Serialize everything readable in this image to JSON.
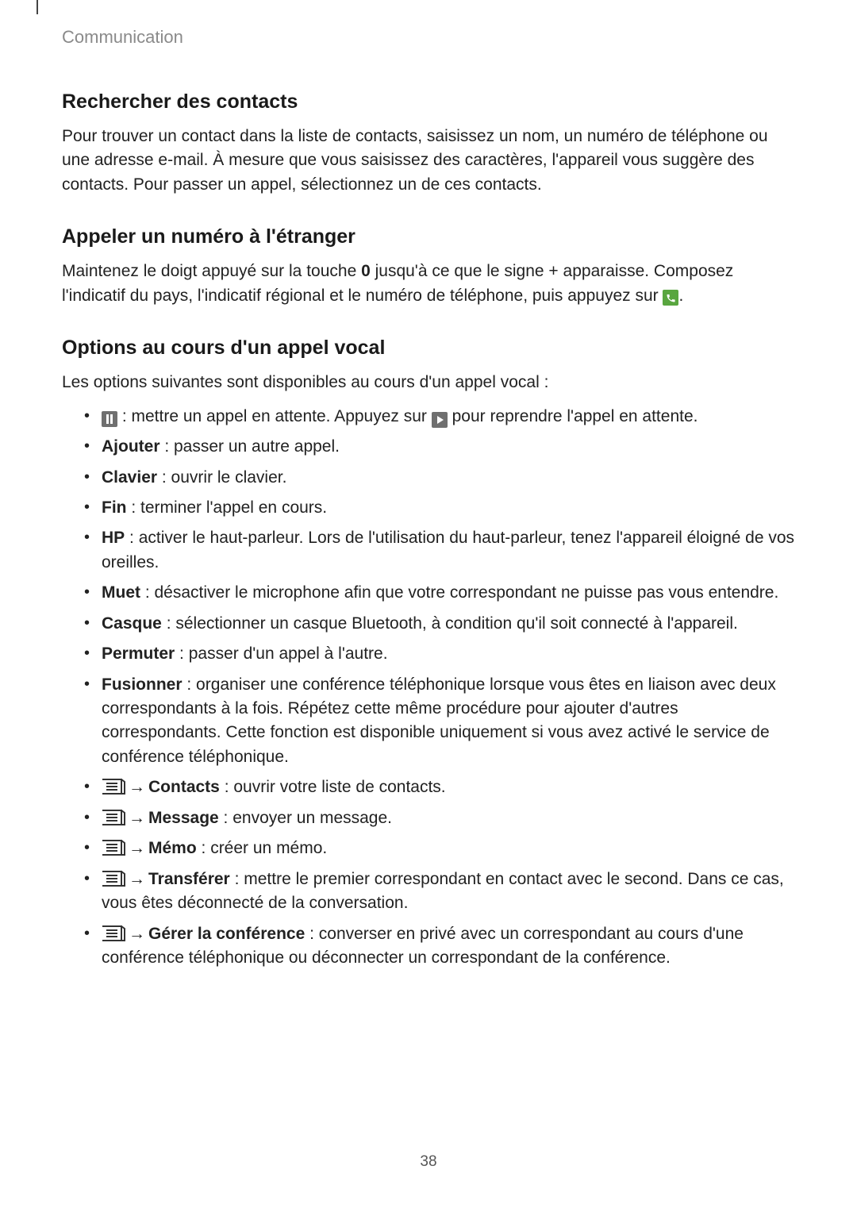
{
  "breadcrumb": "Communication",
  "page_number": "38",
  "arrow": "→",
  "section1": {
    "title": "Rechercher des contacts",
    "body": "Pour trouver un contact dans la liste de contacts, saisissez un nom, un numéro de téléphone ou une adresse e-mail. À mesure que vous saisissez des caractères, l'appareil vous suggère des contacts. Pour passer un appel, sélectionnez un de ces contacts."
  },
  "section2": {
    "title": "Appeler un numéro à l'étranger",
    "body_before": "Maintenez le doigt appuyé sur la touche ",
    "key0": "0",
    "body_mid": " jusqu'à ce que le signe + apparaisse. Composez l'indicatif du pays, l'indicatif régional et le numéro de téléphone, puis appuyez sur ",
    "body_after": "."
  },
  "section3": {
    "title": "Options au cours d'un appel vocal",
    "intro": "Les options suivantes sont disponibles au cours d'un appel vocal :",
    "items": {
      "pause": {
        "before": " : mettre un appel en attente. Appuyez sur ",
        "after": " pour reprendre l'appel en attente."
      },
      "ajouter": {
        "label": "Ajouter",
        "text": " : passer un autre appel."
      },
      "clavier": {
        "label": "Clavier",
        "text": " : ouvrir le clavier."
      },
      "fin": {
        "label": "Fin",
        "text": " : terminer l'appel en cours."
      },
      "hp": {
        "label": "HP",
        "text": " : activer le haut-parleur. Lors de l'utilisation du haut-parleur, tenez l'appareil éloigné de vos oreilles."
      },
      "muet": {
        "label": "Muet",
        "text": " : désactiver le microphone afin que votre correspondant ne puisse pas vous entendre."
      },
      "casque": {
        "label": "Casque",
        "text": " : sélectionner un casque Bluetooth, à condition qu'il soit connecté à l'appareil."
      },
      "permuter": {
        "label": "Permuter",
        "text": " : passer d'un appel à l'autre."
      },
      "fusionner": {
        "label": "Fusionner",
        "text": " : organiser une conférence téléphonique lorsque vous êtes en liaison avec deux correspondants à la fois. Répétez cette même procédure pour ajouter d'autres correspondants. Cette fonction est disponible uniquement si vous avez activé le service de conférence téléphonique."
      },
      "contacts": {
        "label": "Contacts",
        "text": " : ouvrir votre liste de contacts."
      },
      "message": {
        "label": "Message",
        "text": " : envoyer un message."
      },
      "memo": {
        "label": "Mémo",
        "text": " : créer un mémo."
      },
      "transferer": {
        "label": "Transférer",
        "text": " : mettre le premier correspondant en contact avec le second. Dans ce cas, vous êtes déconnecté de la conversation."
      },
      "gerer": {
        "label": "Gérer la conférence",
        "text": " : converser en privé avec un correspondant au cours d'une conférence téléphonique ou déconnecter un correspondant de la conférence."
      }
    }
  }
}
